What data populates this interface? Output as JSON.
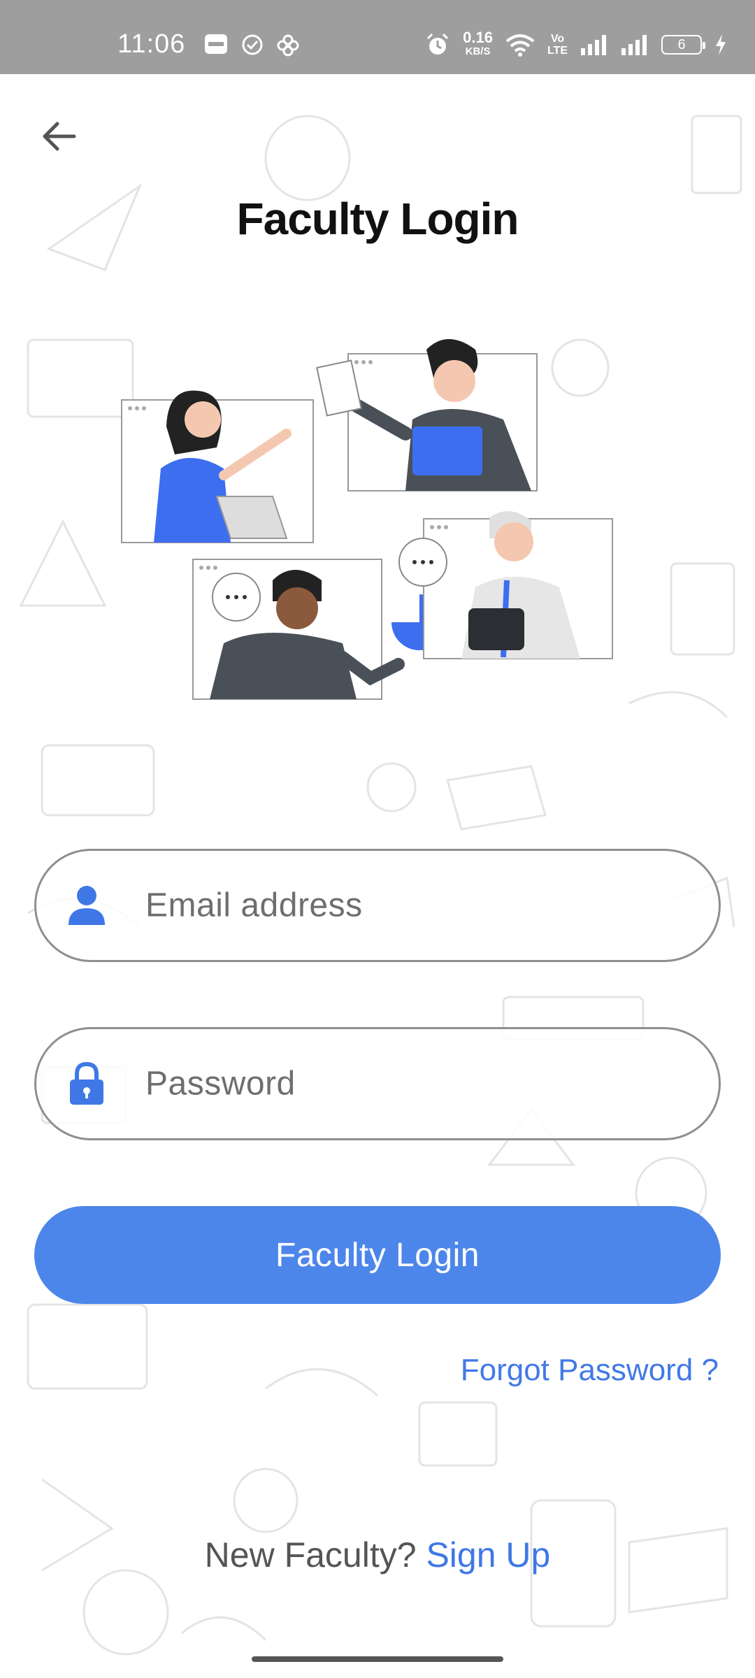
{
  "status_bar": {
    "time": "11:06",
    "net_speed_value": "0.16",
    "net_speed_unit": "KB/S",
    "volte": "Vo\nLTE",
    "battery_level": "6",
    "left_icons": [
      "paytm-icon",
      "check-circle-icon",
      "pinwheel-icon"
    ],
    "right_icons": [
      "alarm-icon",
      "wifi-icon",
      "signal-icon",
      "signal-icon",
      "charging-icon"
    ]
  },
  "header": {
    "back_icon": "arrow-left-icon",
    "title": "Faculty Login"
  },
  "form": {
    "email": {
      "placeholder": "Email address",
      "icon": "person-icon"
    },
    "password": {
      "placeholder": "Password",
      "icon": "lock-icon"
    },
    "submit_label": "Faculty Login",
    "forgot_label": "Forgot Password ?"
  },
  "footer": {
    "question": "New Faculty?",
    "signup_label": "Sign Up"
  },
  "colors": {
    "accent": "#4d86ea",
    "link": "#3f78e6",
    "status_bar": "#9e9e9e",
    "field_border": "#8f8f8f"
  }
}
